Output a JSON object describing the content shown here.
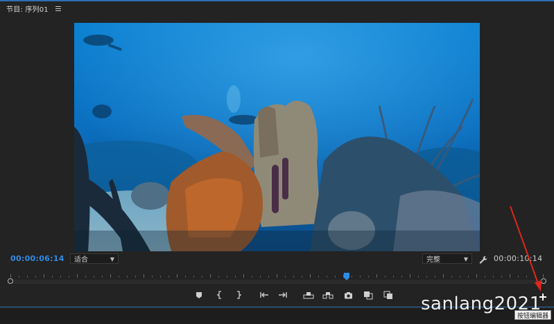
{
  "panel": {
    "title": "节目: 序列01",
    "menu_icon": "hamburger-menu-icon"
  },
  "video": {
    "description_icon": "video-frame"
  },
  "timecode": {
    "current": "00:00:06:14",
    "duration": "00:00:10:14"
  },
  "fit_select": {
    "value": "适合"
  },
  "quality_select": {
    "value": "完整"
  },
  "playback": {
    "position_fraction": 0.63
  },
  "controls": [
    {
      "name": "add-marker-button",
      "icon": "marker-icon"
    },
    {
      "name": "mark-in-button",
      "icon": "mark-in-icon"
    },
    {
      "name": "mark-out-button",
      "icon": "mark-out-icon"
    },
    {
      "name": "go-to-in-button",
      "icon": "go-to-in-icon"
    },
    {
      "name": "go-to-out-button",
      "icon": "go-to-out-icon"
    },
    {
      "name": "lift-button",
      "icon": "lift-icon"
    },
    {
      "name": "extract-button",
      "icon": "extract-icon"
    },
    {
      "name": "export-frame-button",
      "icon": "camera-icon"
    },
    {
      "name": "comparison-view-button",
      "icon": "comparison-icon"
    },
    {
      "name": "proxy-toggle-button",
      "icon": "proxy-icon"
    }
  ],
  "add_button": {
    "icon": "plus-icon",
    "tooltip": "按钮编辑器"
  },
  "watermark": "sanlang2021",
  "colors": {
    "accent": "#2e8ce5",
    "panel_bg": "#232323",
    "annotation_arrow": "#e0261b"
  }
}
